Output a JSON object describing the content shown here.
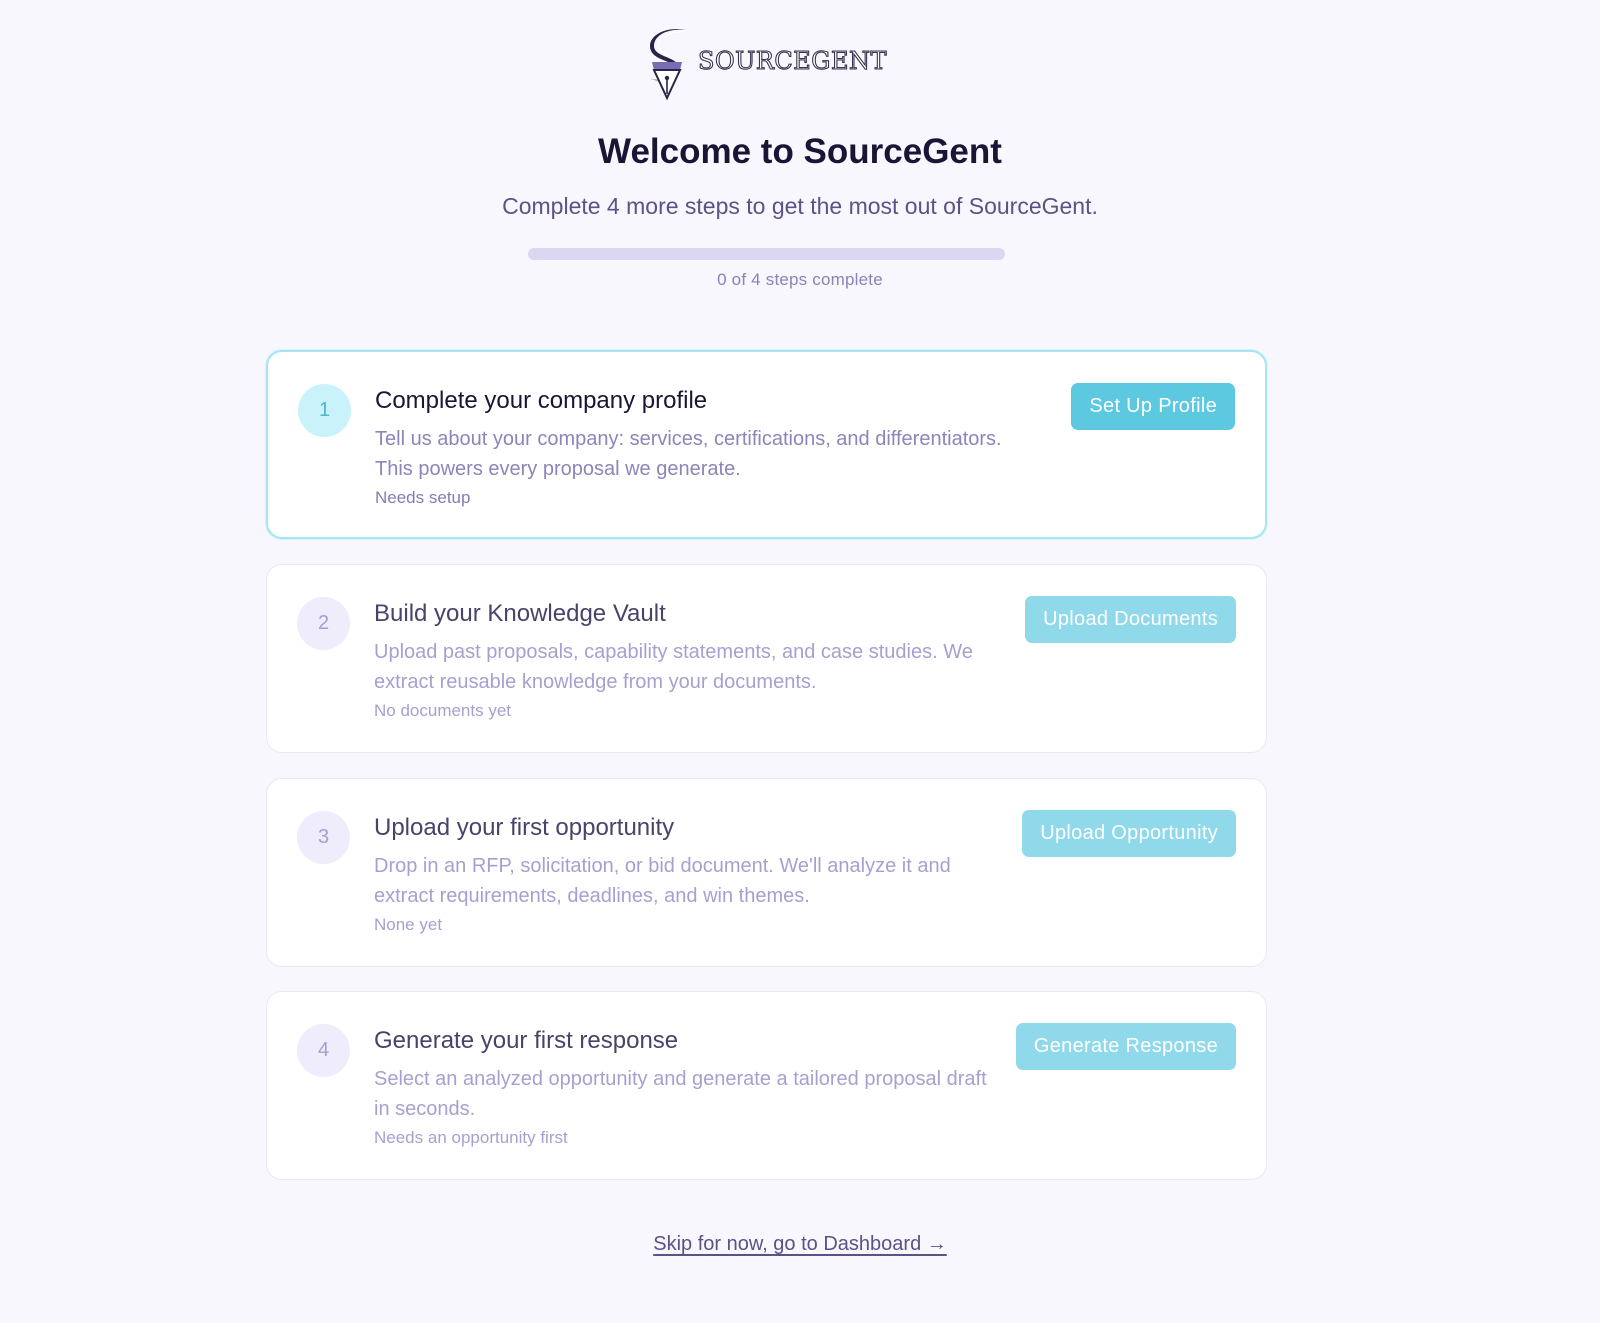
{
  "brand": {
    "name": "SOURCEGENT",
    "logo_icon": "pen-nib-s-logo"
  },
  "header": {
    "title": "Welcome to SourceGent",
    "subtitle": "Complete 4 more steps to get the most out of SourceGent."
  },
  "progress": {
    "completed": 0,
    "total": 4,
    "label": "0 of 4 steps complete",
    "fill_color": "#5cc9e0",
    "track_color": "#ddd6f3"
  },
  "steps": [
    {
      "number": "1",
      "title": "Complete your company profile",
      "description": "Tell us about your company: services, certifications, and differentiators. This powers every proposal we generate.",
      "status": "Needs setup",
      "button_label": "Set Up Profile",
      "active": true
    },
    {
      "number": "2",
      "title": "Build your Knowledge Vault",
      "description": "Upload past proposals, capability statements, and case studies. We extract reusable knowledge from your documents.",
      "status": "No documents yet",
      "button_label": "Upload Documents",
      "active": false
    },
    {
      "number": "3",
      "title": "Upload your first opportunity",
      "description": "Drop in an RFP, solicitation, or bid document. We'll analyze it and extract requirements, deadlines, and win themes.",
      "status": "None yet",
      "button_label": "Upload Opportunity",
      "active": false
    },
    {
      "number": "4",
      "title": "Generate your first response",
      "description": "Select an analyzed opportunity and generate a tailored proposal draft in seconds.",
      "status": "Needs an opportunity first",
      "button_label": "Generate Response",
      "active": false
    }
  ],
  "footer": {
    "skip_label": "Skip for now, go to Dashboard →"
  },
  "colors": {
    "accent": "#5cc9e0",
    "accent_muted": "#8fd9ea",
    "background": "#f8f7fd",
    "text_primary": "#1b1535",
    "text_muted": "#a89fd0"
  }
}
